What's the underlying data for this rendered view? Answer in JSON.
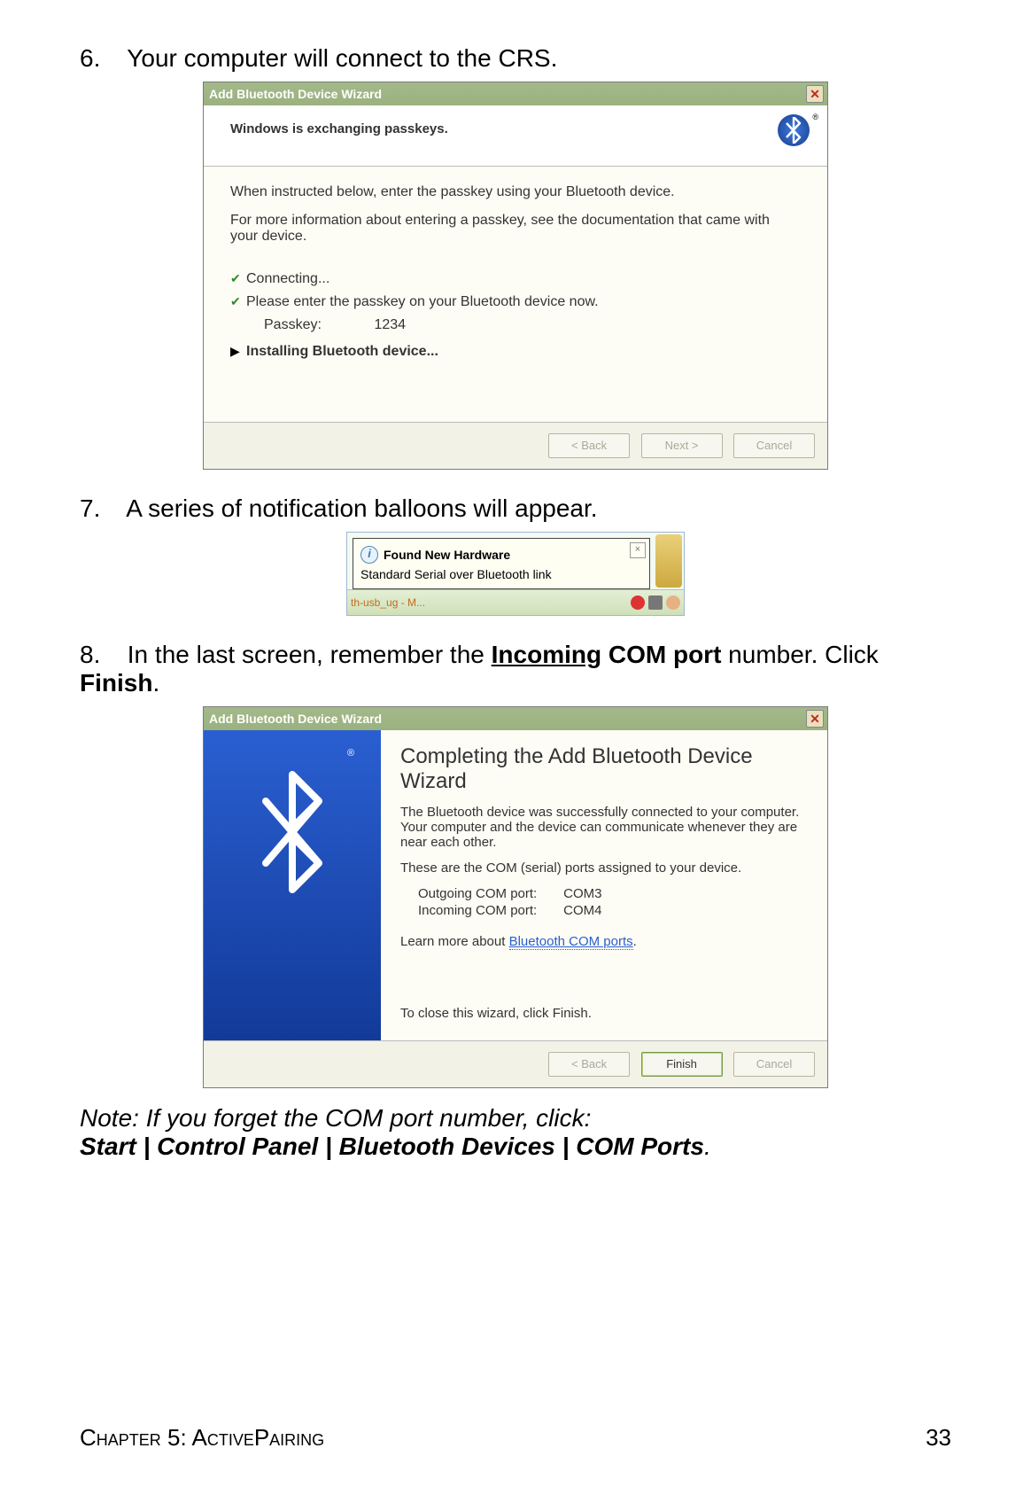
{
  "steps": {
    "s6_num": "6.",
    "s6_text": "Your computer will connect to the CRS.",
    "s7_num": "7.",
    "s7_text": "A series of notification balloons will appear.",
    "s8_num": "8.",
    "s8_text_a": "In the last screen, remember the ",
    "s8_text_b": "Incoming",
    "s8_text_c": " COM port",
    "s8_text_d": " number. Click ",
    "s8_text_e": "Finish",
    "s8_text_f": "."
  },
  "dialog1": {
    "title": "Add Bluetooth Device Wizard",
    "heading": "Windows is exchanging passkeys.",
    "para1": "When instructed below, enter the passkey using your Bluetooth device.",
    "para2": "For more information about entering a passkey, see the documentation that came with your device.",
    "task1": "Connecting...",
    "task2": "Please enter the passkey on your Bluetooth device now.",
    "passkey_label": "Passkey:",
    "passkey_value": "1234",
    "task3": "Installing Bluetooth device...",
    "btn_back": "< Back",
    "btn_next": "Next >",
    "btn_cancel": "Cancel"
  },
  "balloon": {
    "title": "Found New Hardware",
    "subtitle": "Standard Serial over Bluetooth link",
    "task_text": "th-usb_ug - M..."
  },
  "dialog2": {
    "title": "Add Bluetooth Device Wizard",
    "heading": "Completing the Add Bluetooth Device Wizard",
    "para1": "The Bluetooth device was successfully connected to your computer. Your computer and the device can communicate whenever they are near each other.",
    "para2": "These are the COM (serial) ports assigned to your device.",
    "outgoing_label": "Outgoing COM port:",
    "outgoing_value": "COM3",
    "incoming_label": "Incoming COM port:",
    "incoming_value": "COM4",
    "learn_more_a": "Learn more about ",
    "learn_more_b": "Bluetooth COM ports",
    "learn_more_c": ".",
    "close_text": "To close this wizard, click Finish.",
    "btn_back": "< Back",
    "btn_finish": "Finish",
    "btn_cancel": "Cancel"
  },
  "note": {
    "line1": "Note: If you forget the COM port number, click:",
    "line2": "Start | Control Panel | Bluetooth Devices | COM Ports",
    "line2_end": "."
  },
  "footer": {
    "left": "Chapter 5: ActivePairing",
    "right": "33"
  }
}
